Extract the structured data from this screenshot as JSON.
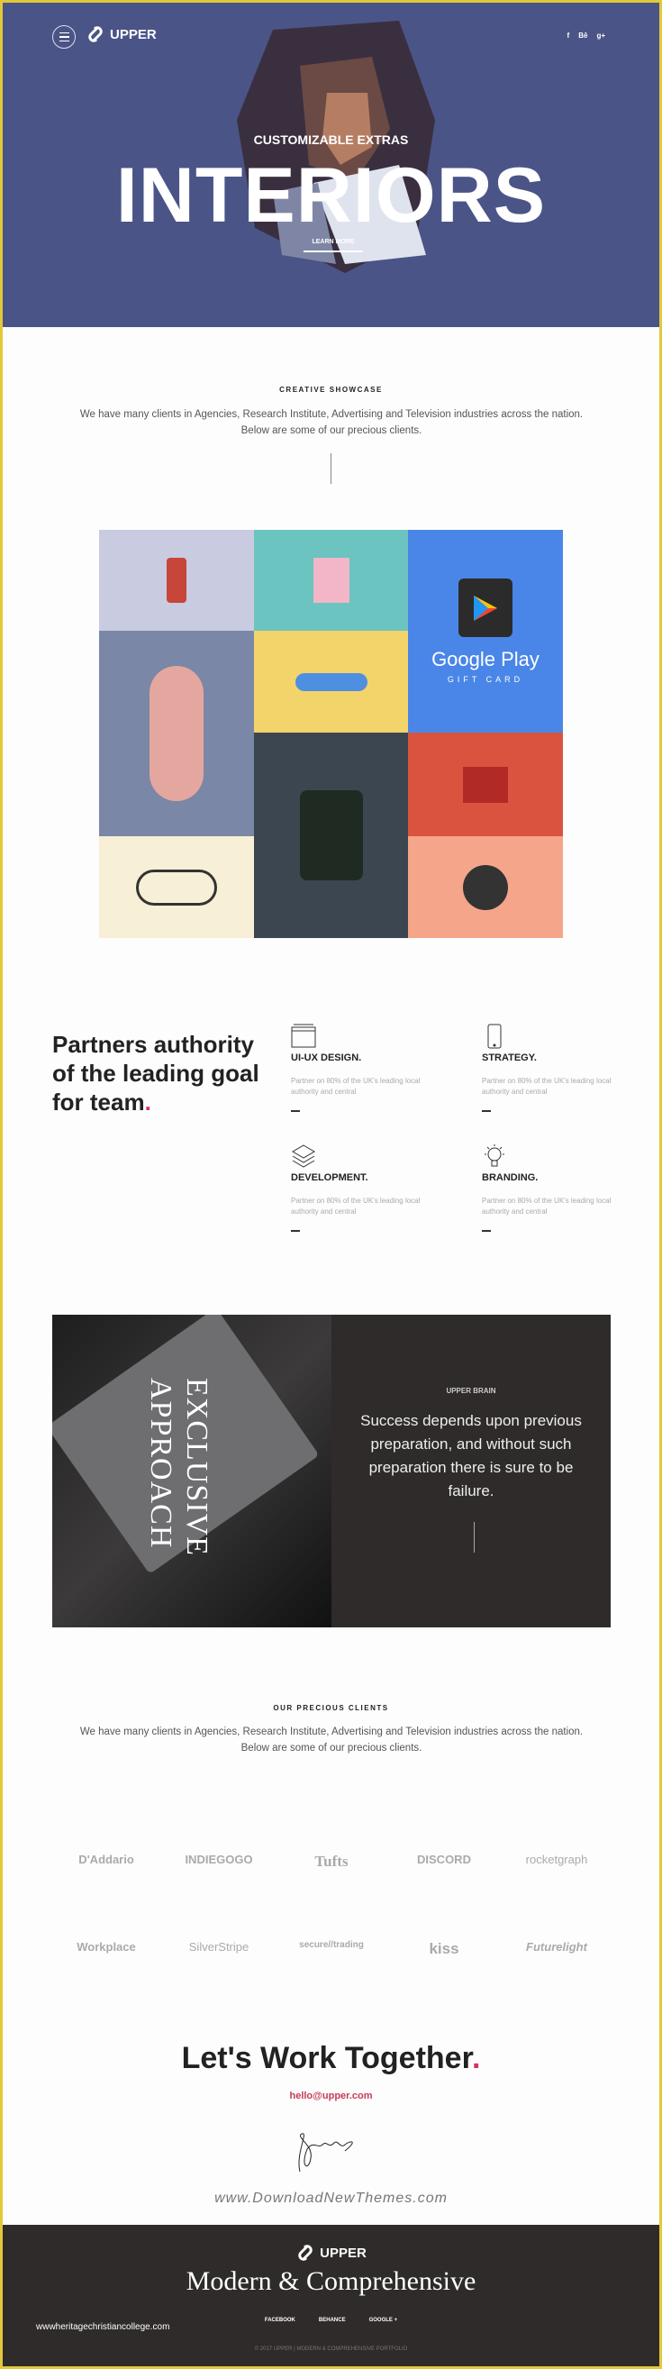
{
  "header": {
    "brand": "UPPER",
    "social": [
      "f",
      "Bē",
      "g+"
    ]
  },
  "hero": {
    "subtitle": "CUSTOMIZABLE EXTRAS",
    "title": "INTERIORS",
    "button": "LEARN MORE",
    "bg_color": "#4a5487"
  },
  "showcase": {
    "kicker": "CREATIVE SHOWCASE",
    "text": "We have many clients in Agencies, Research Institute, Advertising and Television industries across the nation. Below are some of our precious clients.",
    "gift_card": {
      "title": "Google Play",
      "subtitle": "GIFT CARD"
    }
  },
  "services": {
    "heading": "Partners authority of the leading goal for team",
    "heading_dot": ".",
    "items": [
      {
        "icon": "layout-icon",
        "title": "UI-UX DESIGN.",
        "text": "Partner on 80% of the UK's leading local authority and central"
      },
      {
        "icon": "phone-icon",
        "title": "STRATEGY.",
        "text": "Partner on 80% of the UK's leading local authority and central"
      },
      {
        "icon": "layers-icon",
        "title": "DEVELOPMENT.",
        "text": "Partner on 80% of the UK's leading local authority and central"
      },
      {
        "icon": "lightbulb-icon",
        "title": "BRANDING.",
        "text": "Partner on 80% of the UK's leading local authority and central"
      }
    ]
  },
  "brain": {
    "vertical_line1": "EXCLUSIVE",
    "vertical_line2": "APPROACH",
    "kicker": "UPPER BRAIN",
    "quote": "Success depends upon previous preparation, and without such preparation there is sure to be failure."
  },
  "clients": {
    "kicker": "OUR PRECIOUS CLIENTS",
    "text": "We have many clients in Agencies, Research Institute, Advertising and Television industries across the nation. Below are some of our precious clients.",
    "row1": [
      "D'Addario",
      "INDIEGOGO",
      "Tufts",
      "DISCORD",
      "rocketgraph"
    ],
    "row2": [
      "Workplace",
      "SilverStripe",
      "secure//trading",
      "kiss",
      "Futurelight"
    ]
  },
  "contact": {
    "heading": "Let's Work Together",
    "dot": ".",
    "email": "hello@upper.com",
    "watermark": "www.DownloadNewThemes.com",
    "accent": "#c83a5a"
  },
  "footer": {
    "brand": "UPPER",
    "tagline": "Modern & Comprehensive",
    "links": [
      "FACEBOOK",
      "BEHANCE",
      "GOOGLE +"
    ],
    "copyright": "© 2017 UPPER | MODERN & COMPREHENSIVE PORTFOLIO",
    "watermark": "wwwheritagechristiancollege.com"
  }
}
